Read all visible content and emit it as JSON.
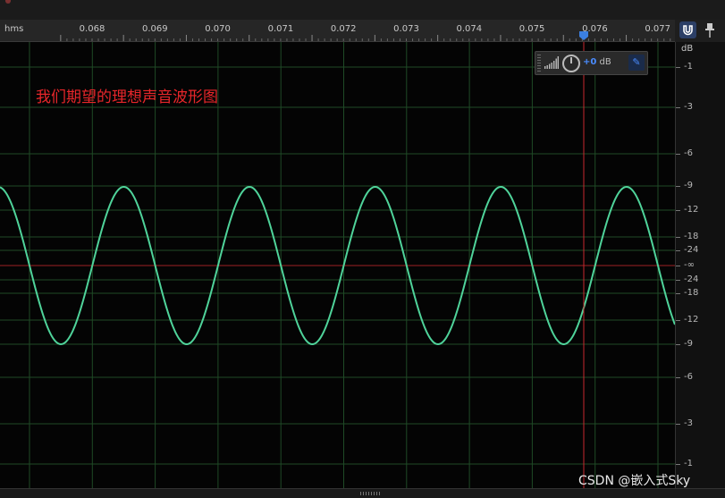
{
  "ruler": {
    "unit": "hms",
    "ticks": [
      "0.068",
      "0.069",
      "0.070",
      "0.071",
      "0.072",
      "0.073",
      "0.074",
      "0.075",
      "0.076",
      "0.077"
    ]
  },
  "db_scale": {
    "unit": "dB",
    "ticks": [
      "-1",
      "-3",
      "-6",
      "-9",
      "-12",
      "-18",
      "-24",
      "-∞",
      "-24",
      "-18",
      "-12",
      "-9",
      "-6",
      "-3",
      "-1"
    ]
  },
  "annotation": "我们期望的理想声音波形图",
  "hud": {
    "gain_value": "+0",
    "gain_unit": "dB"
  },
  "icons": {
    "snap": "magnet-icon",
    "pin": "pin-icon",
    "level": "signal-bars-icon",
    "gain_knob": "knob-icon",
    "hud_pin": "pin-icon"
  },
  "colors": {
    "waveform": "#4fd39a",
    "playhead": "#c8282e",
    "center_line": "#9e1f24",
    "grid": "#1f4a26",
    "annotation": "#e8262a",
    "accent": "#3b7fe0"
  },
  "waveform": {
    "cycles_visible": 5.3
  },
  "watermark": "CSDN @嵌入式Sky"
}
